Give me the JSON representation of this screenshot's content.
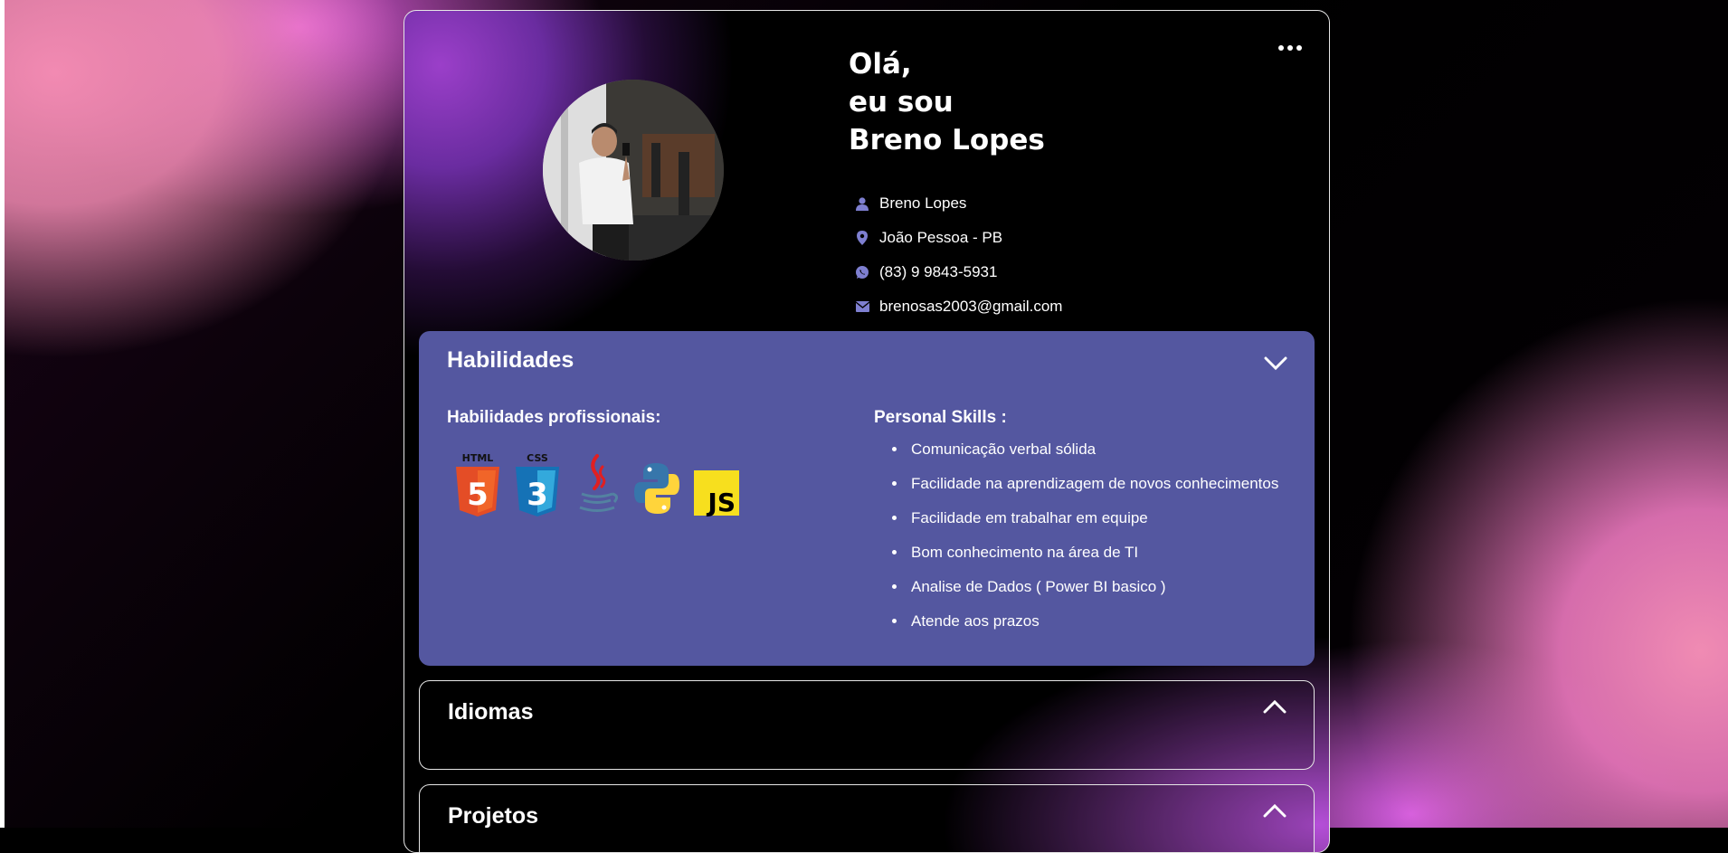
{
  "header": {
    "greeting_lines": [
      "Olá,",
      "eu sou",
      "Breno Lopes"
    ],
    "menu_icon": "more-horizontal-icon"
  },
  "contact": [
    {
      "icon": "user-icon",
      "text": "Breno Lopes"
    },
    {
      "icon": "location-pin-icon",
      "text": "João Pessoa - PB"
    },
    {
      "icon": "whatsapp-icon",
      "text": "(83) 9 9843-5931"
    },
    {
      "icon": "mail-icon",
      "text": "brenosas2003@gmail.com"
    }
  ],
  "skills_panel": {
    "title": "Habilidades",
    "professional_title": "Habilidades profissionais:",
    "personal_title": "Personal Skills :",
    "tech_icons": [
      "html5-icon",
      "css3-icon",
      "java-icon",
      "python-icon",
      "javascript-icon"
    ],
    "tech_labels": {
      "html": "HTML",
      "css": "CSS",
      "html_num": "5",
      "css_num": "3",
      "js": "JS"
    },
    "personal_skills": [
      "Comunicação verbal sólida",
      "Facilidade na aprendizagem de novos conhecimentos",
      "Facilidade em trabalhar em equipe",
      "Bom conhecimento na área de TI",
      "Analise de Dados ( Power BI basico )",
      "Atende aos prazos"
    ]
  },
  "languages_panel": {
    "title": "Idiomas"
  },
  "projects_panel": {
    "title": "Projetos"
  },
  "colors": {
    "panel": "#5457a0",
    "icon_accent": "#7e7fd0"
  }
}
